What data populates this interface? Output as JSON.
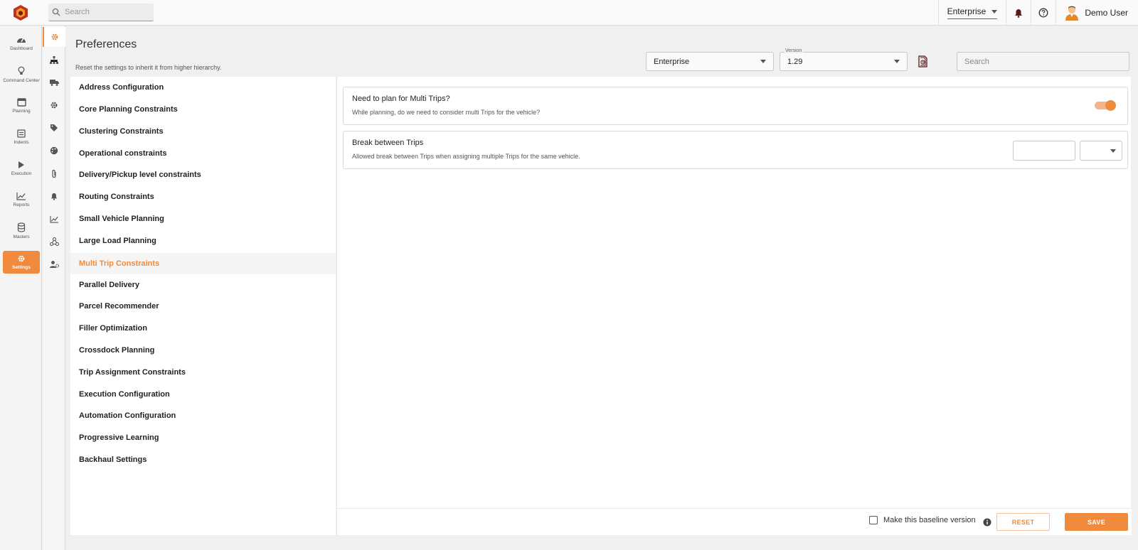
{
  "topbar": {
    "search_placeholder": "Search",
    "org_select": "Enterprise",
    "user_name": "Demo User"
  },
  "nav": [
    {
      "label": "Dashboard",
      "icon": "dashboard-icon"
    },
    {
      "label": "Command Center",
      "icon": "lightbulb-icon"
    },
    {
      "label": "Planning",
      "icon": "calendar-icon"
    },
    {
      "label": "Indents",
      "icon": "list-icon"
    },
    {
      "label": "Execution",
      "icon": "play-icon"
    },
    {
      "label": "Reports",
      "icon": "chart-icon"
    },
    {
      "label": "Masters",
      "icon": "database-icon"
    },
    {
      "label": "Settings",
      "icon": "gear-icon",
      "active": true
    }
  ],
  "subnav_icons": [
    "gear-icon",
    "hierarchy-icon",
    "truck-icon",
    "settings-icon",
    "tag-icon",
    "palette-icon",
    "paperclip-icon",
    "bell-icon",
    "chart-icon",
    "network-icon",
    "user-settings-icon"
  ],
  "header": {
    "title": "Preferences",
    "subtitle": "Reset the settings to inherit it from higher hierarchy.",
    "org_select": "Enterprise",
    "version_label": "Version",
    "version_value": "1.29",
    "search_placeholder": "Search"
  },
  "categories": [
    "Address Configuration",
    "Core Planning Constraints",
    "Clustering Constraints",
    "Operational constraints",
    "Delivery/Pickup level constraints",
    "Routing Constraints",
    "Small Vehicle Planning",
    "Large Load Planning",
    "Multi Trip Constraints",
    "Parallel Delivery",
    "Parcel Recommender",
    "Filler Optimization",
    "Crossdock Planning",
    "Trip Assignment Constraints",
    "Execution Configuration",
    "Automation Configuration",
    "Progressive Learning",
    "Backhaul Settings"
  ],
  "active_category": "Multi Trip Constraints",
  "settings": [
    {
      "title": "Need to plan for Multi Trips?",
      "description": "While planning, do we need to consider multi Trips for the vehicle?",
      "control": "toggle",
      "enabled": true
    },
    {
      "title": "Break between Trips",
      "description": "Allowed break between Trips when assigning multiple Trips for the same vehicle.",
      "control": "number-with-unit",
      "value": "",
      "unit": ""
    }
  ],
  "footer": {
    "baseline_label": "Make this baseline version",
    "baseline_checked": false,
    "reset_label": "RESET",
    "save_label": "SAVE"
  },
  "colors": {
    "accent": "#f08a3c",
    "accent_light": "#f4b48a"
  }
}
